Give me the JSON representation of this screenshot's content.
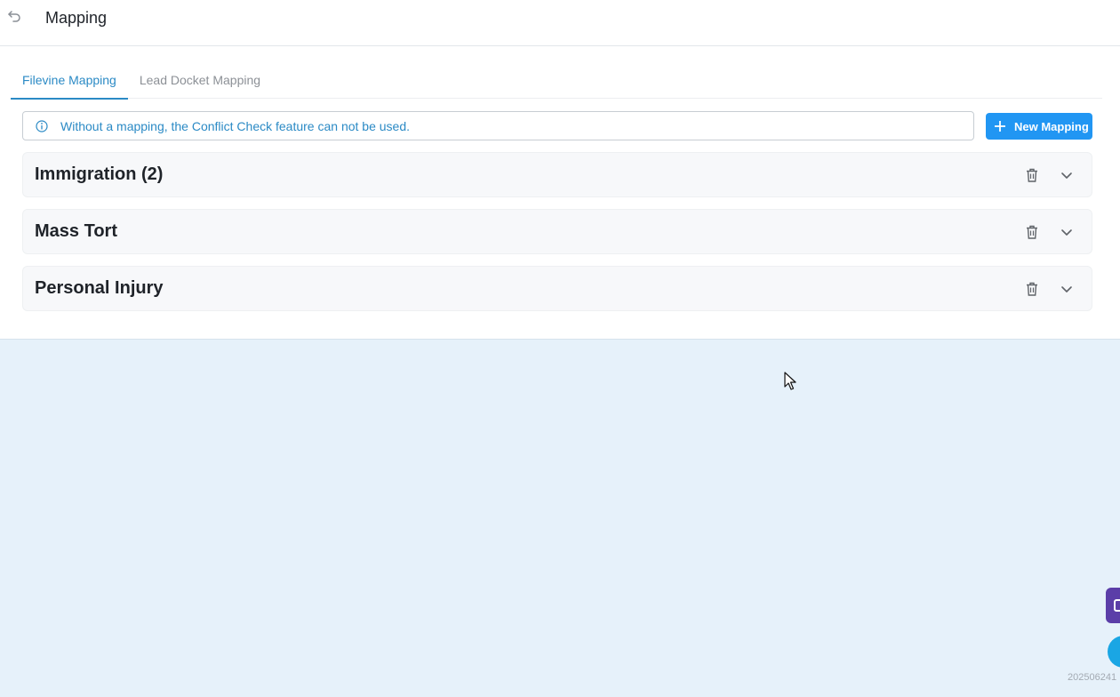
{
  "header": {
    "back_icon": "return-arrow-icon",
    "title": "Mapping"
  },
  "tabs": [
    {
      "label": "Filevine Mapping",
      "active": true
    },
    {
      "label": "Lead Docket Mapping",
      "active": false
    }
  ],
  "notice": {
    "icon": "info-circle-icon",
    "text": "Without a mapping, the Conflict Check feature can not be used."
  },
  "actions": {
    "new_mapping_label": "New Mapping",
    "new_mapping_icon": "plus-icon"
  },
  "groups": [
    {
      "title": "Immigration (2)",
      "delete_icon": "trash-icon",
      "expand_icon": "chevron-down-icon"
    },
    {
      "title": "Mass Tort",
      "delete_icon": "trash-icon",
      "expand_icon": "chevron-down-icon"
    },
    {
      "title": "Personal Injury",
      "delete_icon": "trash-icon",
      "expand_icon": "chevron-down-icon"
    }
  ],
  "footer": {
    "version_text": "202506241"
  },
  "colors": {
    "accent": "#2b8ac5",
    "primary_button": "#2196f3",
    "background": "#e6f1fa",
    "widget_purple": "#5b3ea8",
    "chat_blue": "#1aa6e4"
  }
}
